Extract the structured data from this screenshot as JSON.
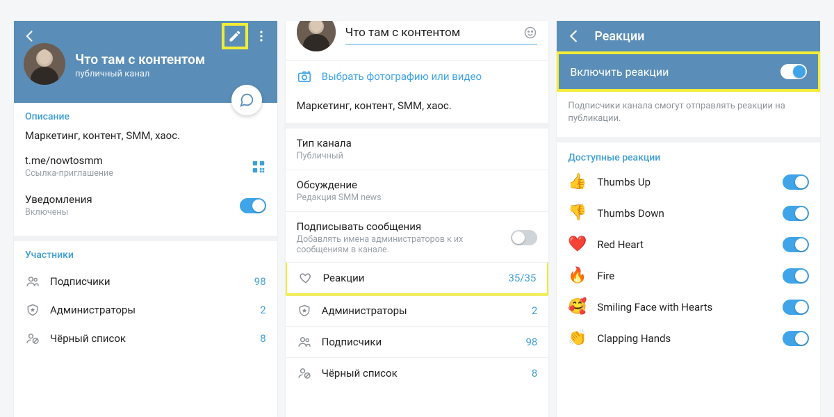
{
  "panel1": {
    "title": "Что там с контентом",
    "subtitle": "публичный канал",
    "desc_head": "Описание",
    "desc_text": "Маркетинг, контент, SMM, хаос.",
    "link": "t.me/nowtosmm",
    "link_sub": "Ссылка-приглашение",
    "notif_label": "Уведомления",
    "notif_sub": "Включены",
    "members_head": "Участники",
    "subs_label": "Подписчики",
    "subs_value": "98",
    "admins_label": "Администраторы",
    "admins_value": "2",
    "black_label": "Чёрный список",
    "black_value": "8"
  },
  "panel2": {
    "name": "Что там с контентом",
    "pick_media": "Выбрать фотографию или видео",
    "desc": "Маркетинг, контент, SMM, хаос.",
    "type_label": "Тип канала",
    "type_value": "Публичный",
    "discussion_label": "Обсуждение",
    "discussion_sub": "Редакция SMM news",
    "sign_label": "Подписывать сообщения",
    "sign_sub": "Добавлять имена администраторов к их сообщениям в канале.",
    "reactions_label": "Реакции",
    "reactions_value": "35/35",
    "admins_label": "Администраторы",
    "admins_value": "2",
    "subs_label": "Подписчики",
    "subs_value": "98",
    "black_label": "Чёрный список",
    "black_value": "8"
  },
  "panel3": {
    "header": "Реакции",
    "enable_label": "Включить реакции",
    "note": "Подписчики канала смогут отправлять реакции на публикации.",
    "avail_head": "Доступные реакции",
    "reactions": [
      {
        "emoji": "👍",
        "label": "Thumbs Up"
      },
      {
        "emoji": "👎",
        "label": "Thumbs Down"
      },
      {
        "emoji": "❤️",
        "label": "Red Heart"
      },
      {
        "emoji": "🔥",
        "label": "Fire"
      },
      {
        "emoji": "🥰",
        "label": "Smiling Face with Hearts"
      },
      {
        "emoji": "👏",
        "label": "Clapping Hands"
      }
    ]
  }
}
